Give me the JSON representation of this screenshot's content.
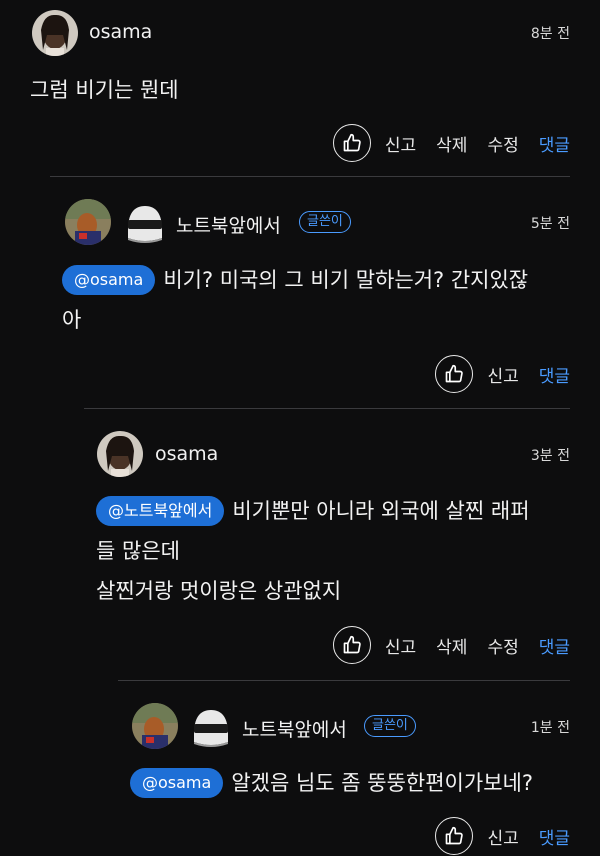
{
  "comments": [
    {
      "nickname": "osama",
      "time": "8분 전",
      "lines": [
        "그럼 비기는 뭔데"
      ],
      "actions": {
        "report": "신고",
        "delete": "삭제",
        "edit": "수정",
        "reply": "댓글"
      }
    },
    {
      "nickname": "노트북앞에서",
      "badge": "글쓴이",
      "time": "5분 전",
      "mention": "@osama",
      "lines": [
        "비기? 미국의 그 비기 말하는거? 간지있잖",
        "아"
      ],
      "actions": {
        "report": "신고",
        "reply": "댓글"
      }
    },
    {
      "nickname": "osama",
      "time": "3분 전",
      "mention": "@노트북앞에서",
      "lines": [
        "비기뿐만 아니라 외국에 살찐 래퍼",
        "들 많은데",
        "살찐거랑 멋이랑은 상관없지"
      ],
      "actions": {
        "report": "신고",
        "delete": "삭제",
        "edit": "수정",
        "reply": "댓글"
      }
    },
    {
      "nickname": "노트북앞에서",
      "badge": "글쓴이",
      "time": "1분 전",
      "mention": "@osama",
      "lines": [
        "알겠음 님도 좀 뚱뚱한편이가보네?"
      ],
      "actions": {
        "report": "신고",
        "reply": "댓글"
      }
    }
  ],
  "icons": {
    "like": "thumbs-up-icon",
    "helmet": "robot-helmet-icon"
  },
  "colors": {
    "background": "#0d0d0e",
    "accent": "#4a9bff",
    "mention_bg": "#1e6fd6",
    "divider": "#3a3a3d"
  }
}
